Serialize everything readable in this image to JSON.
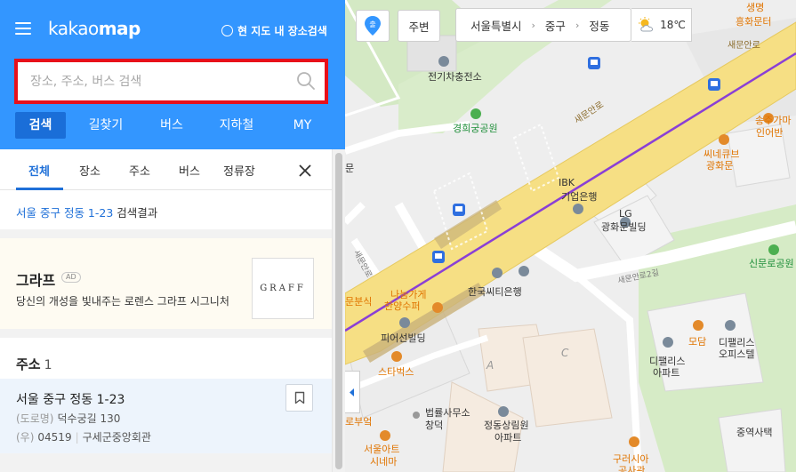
{
  "app": {
    "logo_light": "kakao",
    "logo_bold": "map",
    "map_search_option": "현 지도 내 장소검색"
  },
  "search": {
    "placeholder": "장소, 주소, 버스 검색",
    "value": ""
  },
  "nav_tabs": [
    {
      "label": "검색",
      "active": true
    },
    {
      "label": "길찾기"
    },
    {
      "label": "버스"
    },
    {
      "label": "지하철"
    },
    {
      "label": "MY"
    }
  ],
  "sub_tabs": [
    {
      "label": "전체",
      "active": true
    },
    {
      "label": "장소"
    },
    {
      "label": "주소"
    },
    {
      "label": "버스"
    },
    {
      "label": "정류장"
    }
  ],
  "result": {
    "query": "서울 중구 정동 1-23",
    "suffix": "검색결과"
  },
  "ad": {
    "title": "그라프",
    "badge": "AD",
    "description": "당신의 개성을 빛내주는 로렌스 그라프 시그니처",
    "logo_text": "GRAFF"
  },
  "address_section": {
    "title": "주소",
    "count": "1",
    "item": {
      "main": "서울 중구 정동 1-23",
      "road_tag": "(도로명)",
      "road_address": "덕수궁길 130",
      "zip_tag": "(우)",
      "zip": "04519",
      "building": "구세군중앙회관"
    }
  },
  "map_controls": {
    "location_icon_text": "출",
    "nearby_label": "주변",
    "breadcrumb": [
      "서울특별시",
      "중구",
      "정동"
    ],
    "temperature": "18℃"
  },
  "map_labels": {
    "ev_station": "전기차충전소",
    "park": "경희궁공원",
    "ibk_1": "IBK",
    "ibk_2": "기업은행",
    "lg_1": "LG",
    "lg_2": "광화문빌딩",
    "citibank": "한국씨티은행",
    "nanugage_1": "나눔가게",
    "nanugage_2": "한양수퍼",
    "peer_building": "피어선빌딩",
    "starbucks": "스타벅스",
    "law_office_1": "법률사무소",
    "law_office_2": "창덕",
    "jeongdong_1": "정동상림원",
    "jeongdong_2": "아파트",
    "seoul_art_1": "서울아트",
    "seoul_art_2": "시네마",
    "modam": "모담",
    "dpalace_apt_1": "디팰리스",
    "dpalace_apt_2": "아파트",
    "dpalace_off_1": "디팰리스",
    "dpalace_off_2": "오피스텔",
    "songjuk_1": "송주가마",
    "songjuk_2": "인어반",
    "seecube_1": "씨네큐브",
    "seecube_2": "광화문",
    "sinmunro_park": "신문로공원",
    "jungyeok": "중역사택",
    "guryeo_1": "구러시아",
    "guryeo_2": "공사관",
    "road_saemunan": "새문안로",
    "road_saemunan_2": "새문안로",
    "road_saemunan2gil": "새문안로2길",
    "road_saemunan_side": "새문안로",
    "edge_top_right_1": "생명",
    "edge_top_right_2": "흥화문터",
    "edge_left_1": "문",
    "edge_left_2": "문분식",
    "edge_left_3": "로부엌",
    "block_a": "A",
    "block_c": "C"
  },
  "colors": {
    "header_blue": "#3396ff",
    "active_tab": "#1a6ed8",
    "search_border": "#e8101a",
    "road_yellow": "#f6df84",
    "subway_purple": "#8a3fd6",
    "green_area": "#cfe7bf"
  }
}
